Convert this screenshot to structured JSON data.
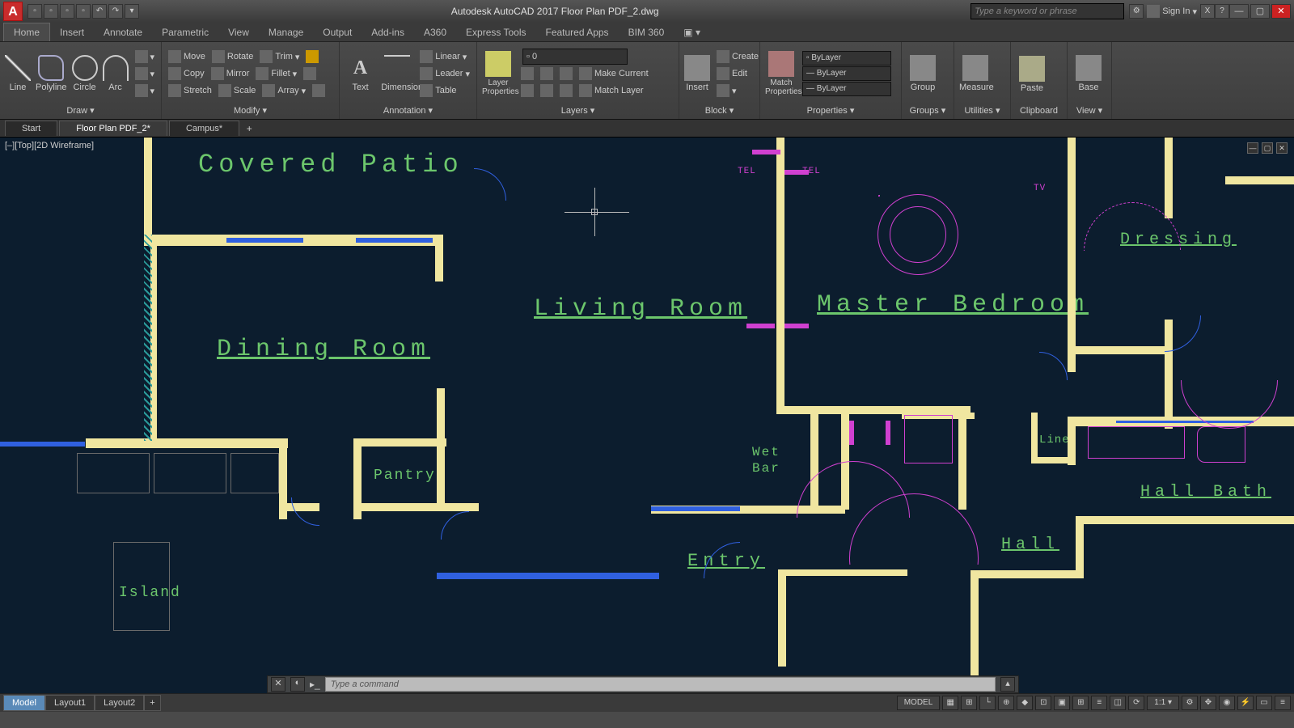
{
  "app": {
    "title": "Autodesk AutoCAD 2017     Floor Plan PDF_2.dwg",
    "search_ph": "Type a keyword or phrase",
    "signin": "Sign In"
  },
  "ribbon_tabs": [
    "Home",
    "Insert",
    "Annotate",
    "Parametric",
    "View",
    "Manage",
    "Output",
    "Add-ins",
    "A360",
    "Express Tools",
    "Featured Apps",
    "BIM 360"
  ],
  "panels": {
    "draw": {
      "title": "Draw ▾",
      "line": "Line",
      "polyline": "Polyline",
      "circle": "Circle",
      "arc": "Arc"
    },
    "modify": {
      "title": "Modify ▾",
      "move": "Move",
      "rotate": "Rotate",
      "trim": "Trim",
      "copy": "Copy",
      "mirror": "Mirror",
      "fillet": "Fillet",
      "stretch": "Stretch",
      "scale": "Scale",
      "array": "Array"
    },
    "annotation": {
      "title": "Annotation ▾",
      "text": "Text",
      "dimension": "Dimension",
      "linear": "Linear",
      "leader": "Leader",
      "table": "Table"
    },
    "layers": {
      "title": "Layers ▾",
      "props": "Layer Properties",
      "current": "0",
      "make": "Make Current",
      "match": "Match Layer"
    },
    "block": {
      "title": "Block ▾",
      "insert": "Insert",
      "create": "Create",
      "edit": "Edit"
    },
    "properties": {
      "title": "Properties ▾",
      "match": "Match Properties",
      "bylayer": "ByLayer"
    },
    "groups": {
      "title": "Groups ▾",
      "group": "Group"
    },
    "utilities": {
      "title": "Utilities ▾",
      "measure": "Measure"
    },
    "clipboard": {
      "title": "Clipboard",
      "paste": "Paste"
    },
    "view": {
      "title": "View ▾",
      "base": "Base"
    }
  },
  "file_tabs": [
    "Start",
    "Floor Plan PDF_2*",
    "Campus*"
  ],
  "viewport": "[–][Top][2D Wireframe]",
  "rooms": {
    "patio": "Covered  Patio",
    "dining": "Dining  Room",
    "living": "Living  Room",
    "master": "Master  Bedroom",
    "pantry": "Pantry",
    "wetbar1": "Wet",
    "wetbar2": "Bar",
    "entry": "Entry",
    "dressing": "Dressing",
    "linen": "Linen",
    "hallbath": "Hall  Bath",
    "hall": "Hall",
    "island": "Island"
  },
  "annots": {
    "tel1": "TEL",
    "tel2": "TEL",
    "tv": "TV"
  },
  "cmd_ph": "Type a command",
  "model_tabs": [
    "Model",
    "Layout1",
    "Layout2"
  ],
  "status": {
    "model": "MODEL",
    "scale": "1:1"
  }
}
